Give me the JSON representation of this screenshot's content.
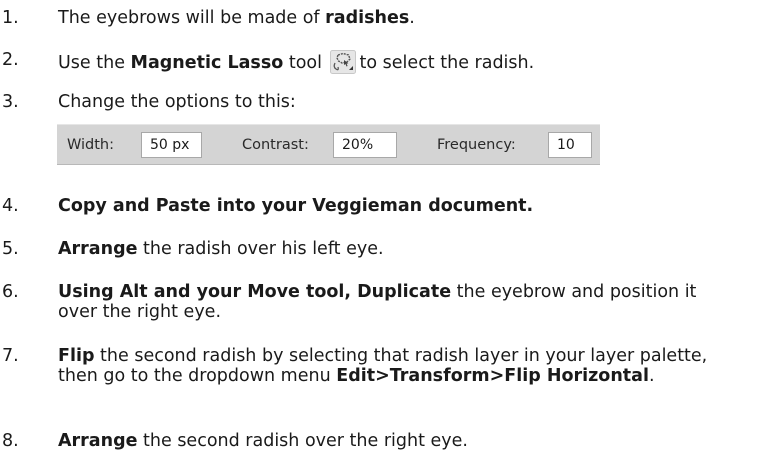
{
  "steps": [
    {
      "number": "1.",
      "parts": [
        {
          "text": "The eyebrows will be made of ",
          "bold": false
        },
        {
          "text": "radishes",
          "bold": true
        },
        {
          "text": ".",
          "bold": false
        }
      ]
    },
    {
      "number": "2.",
      "parts": [
        {
          "text": "Use the ",
          "bold": false
        },
        {
          "text": "Magnetic Lasso",
          "bold": true
        },
        {
          "text": " tool ",
          "bold": false
        }
      ],
      "icon": "magnetic-lasso-icon",
      "after_icon": "to select the radish."
    },
    {
      "number": "3.",
      "parts": [
        {
          "text": "Change the options to this:",
          "bold": false
        }
      ]
    },
    {
      "number": "4.",
      "parts": [
        {
          "text": "Copy and Paste into your Veggieman document.",
          "bold": true
        }
      ]
    },
    {
      "number": "5.",
      "parts": [
        {
          "text": "Arrange",
          "bold": true
        },
        {
          "text": " the radish over his left eye.",
          "bold": false
        }
      ]
    },
    {
      "number": "6.",
      "parts": [
        {
          "text": "Using Alt and your Move tool, Duplicate",
          "bold": true
        },
        {
          "text": " the eyebrow and position it over the right eye.",
          "bold": false
        }
      ]
    },
    {
      "number": "7.",
      "parts": [
        {
          "text": "Flip",
          "bold": true
        },
        {
          "text": " the second radish by selecting that radish layer in your layer palette, then go to the dropdown menu ",
          "bold": false
        },
        {
          "text": "Edit>Transform>Flip Horizontal",
          "bold": true
        },
        {
          "text": ".",
          "bold": false
        }
      ]
    },
    {
      "number": "8.",
      "parts": [
        {
          "text": "Arrange",
          "bold": true
        },
        {
          "text": " the second radish over the right eye.",
          "bold": false
        }
      ]
    }
  ],
  "options_bar": {
    "width_label": "Width:",
    "width_value": "50 px",
    "contrast_label": "Contrast:",
    "contrast_value": "20%",
    "frequency_label": "Frequency:",
    "frequency_value": "10"
  },
  "colors": {
    "text": "#1a1a1a",
    "options_bar_background": "#d4d4d4"
  }
}
